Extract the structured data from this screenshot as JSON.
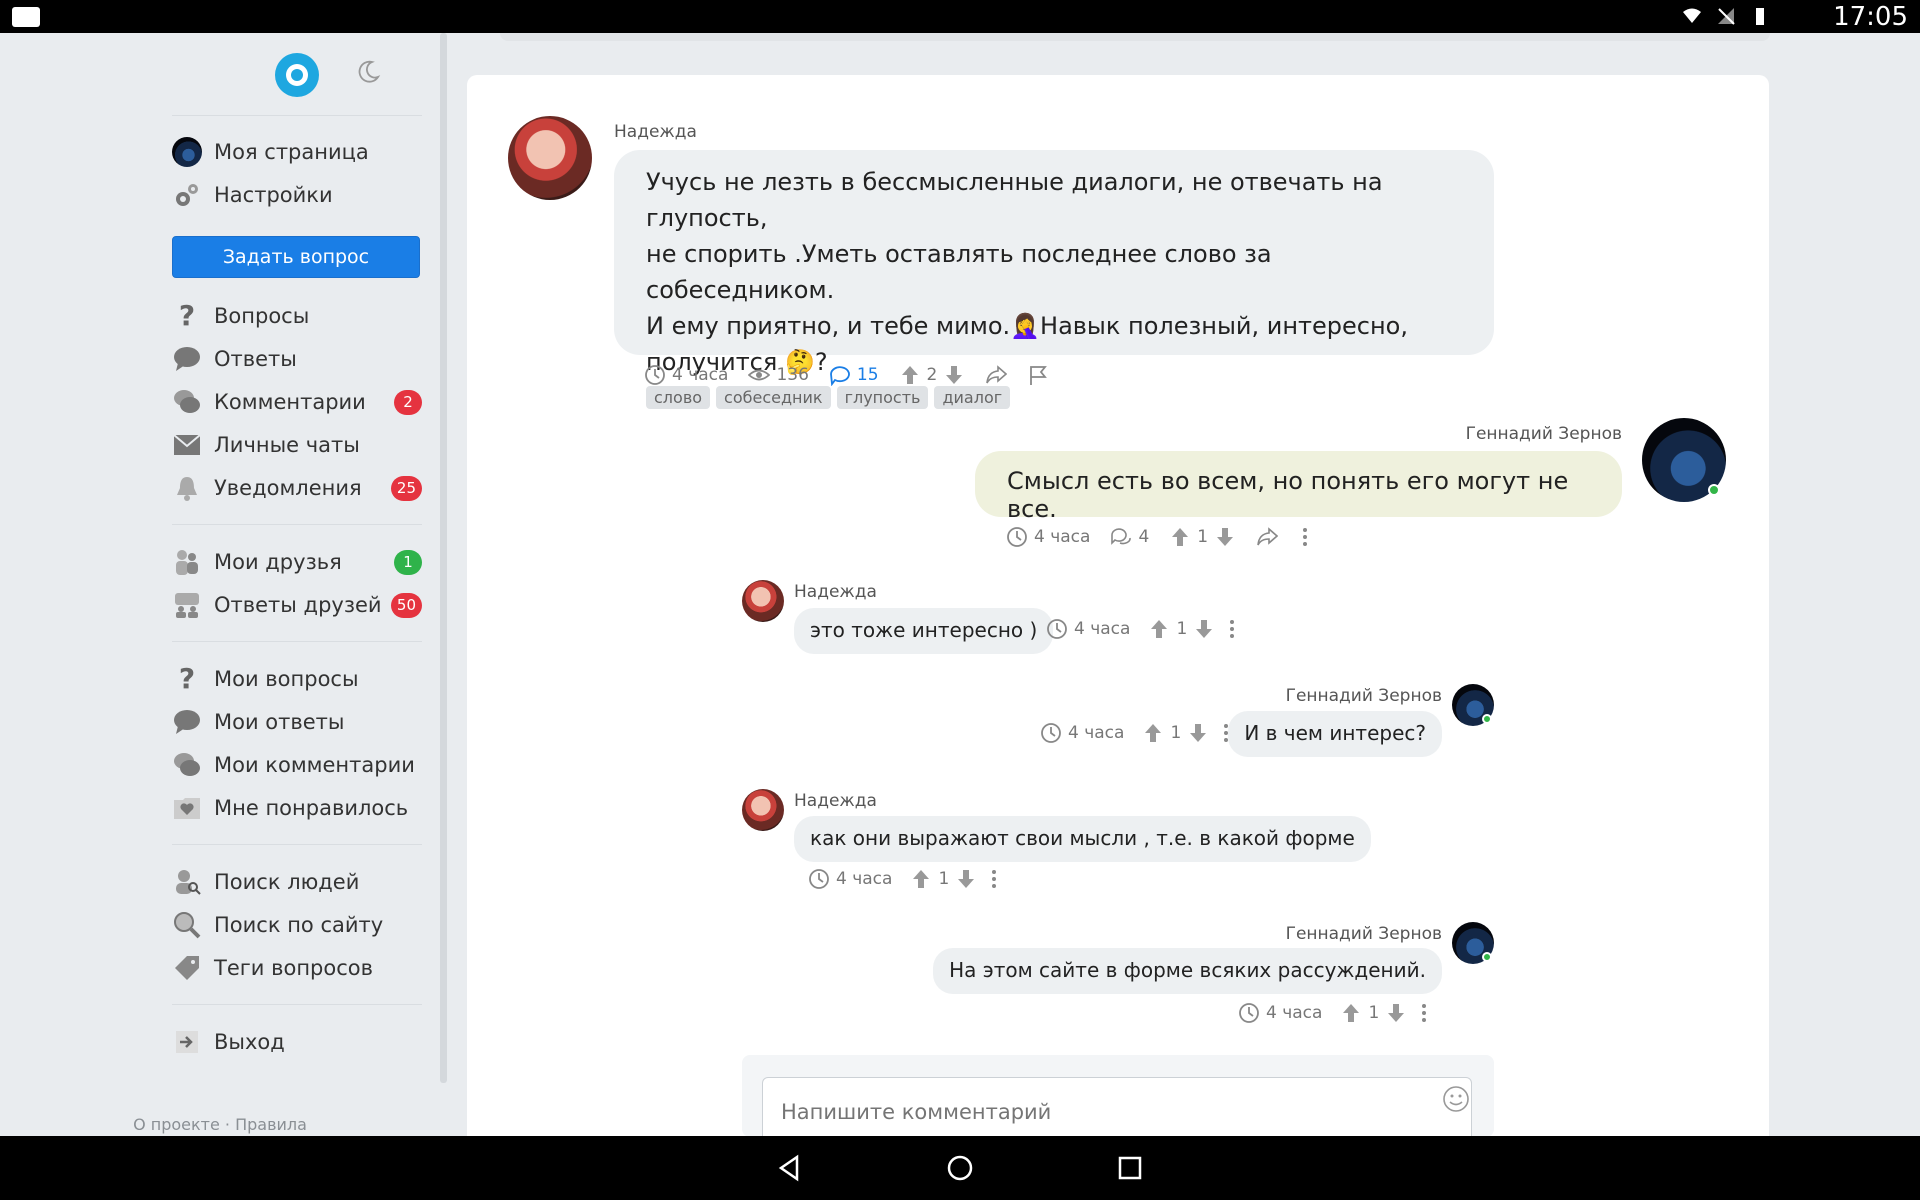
{
  "status_bar": {
    "time": "17:05"
  },
  "sidebar": {
    "items_a": [
      {
        "label": "Моя страница",
        "icon": "avatar-icon"
      },
      {
        "label": "Настройки",
        "icon": "gears-icon"
      }
    ],
    "ask_button": "Задать вопрос",
    "items_b": [
      {
        "label": "Вопросы",
        "icon": "question-icon",
        "badge": ""
      },
      {
        "label": "Ответы",
        "icon": "speech-bubble-icon",
        "badge": ""
      },
      {
        "label": "Комментарии",
        "icon": "comments-icon",
        "badge": "2"
      },
      {
        "label": "Личные чаты",
        "icon": "envelope-icon",
        "badge": ""
      },
      {
        "label": "Уведомления",
        "icon": "bell-icon",
        "badge": "25"
      }
    ],
    "items_c": [
      {
        "label": "Мои друзья",
        "icon": "friends-icon",
        "badge": "1"
      },
      {
        "label": "Ответы друзей",
        "icon": "friends-answers-icon",
        "badge": "50"
      }
    ],
    "items_d": [
      {
        "label": "Мои вопросы",
        "icon": "question-icon"
      },
      {
        "label": "Мои ответы",
        "icon": "speech-bubble-icon"
      },
      {
        "label": "Мои комментарии",
        "icon": "comments-icon"
      },
      {
        "label": "Мне понравилось",
        "icon": "heart-folder-icon"
      }
    ],
    "items_e": [
      {
        "label": "Поиск людей",
        "icon": "search-people-icon"
      },
      {
        "label": "Поиск по сайту",
        "icon": "search-icon"
      },
      {
        "label": "Теги вопросов",
        "icon": "tag-icon"
      }
    ],
    "logout": "Выход",
    "footer": "О проекте · Правила"
  },
  "post": {
    "author": "Надежда",
    "text_lines": [
      "Учусь не лезть в бессмысленные диалоги, не отвечать на глупость,",
      "не спорить .Уметь оставлять последнее слово за собеседником.",
      "И ему приятно, и тебе мимо.🤦‍♀️Навык полезный, интересно,",
      "получится 🤔?"
    ],
    "tags": [
      "слово",
      "собеседник",
      "глупость",
      "диалог"
    ],
    "time": "4 часа",
    "views": "136",
    "comments": "15",
    "votes": "2"
  },
  "answer": {
    "author": "Геннадий Зернов",
    "text": "Смысл есть во всем, но понять его могут не все.",
    "time": "4 часа",
    "comments": "4",
    "votes": "1"
  },
  "replies": [
    {
      "author": "Надежда",
      "text": "это тоже интересно )",
      "time": "4 часа",
      "votes": "1"
    },
    {
      "author": "Геннадий Зернов",
      "text": "И в чем интерес?",
      "time": "4 часа",
      "votes": "1"
    },
    {
      "author": "Надежда",
      "text": "как они выражают свои мысли , т.е. в какой форме",
      "time": "4 часа",
      "votes": "1"
    },
    {
      "author": "Геннадий Зернов",
      "text": "На этом сайте в форме всяких рассуждений.",
      "time": "4 часа",
      "votes": "1"
    }
  ],
  "comment_input": {
    "placeholder": "Напишите комментарий"
  }
}
